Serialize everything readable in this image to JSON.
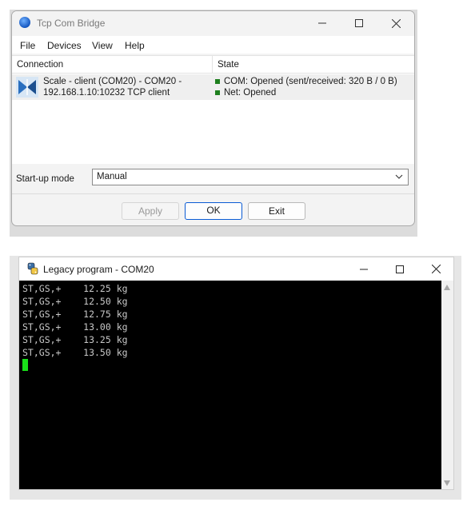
{
  "bridge": {
    "title": "Tcp Com Bridge",
    "menu": [
      "File",
      "Devices",
      "View",
      "Help"
    ],
    "columns": {
      "connection": "Connection",
      "state": "State"
    },
    "row": {
      "line1": "Scale - client (COM20) - COM20 -",
      "line2": "192.168.1.10:10232 TCP client",
      "com_state": "COM: Opened (sent/received: 320 B / 0 B)",
      "net_state": "Net: Opened"
    },
    "startup": {
      "label": "Start-up mode",
      "value": "Manual"
    },
    "buttons": {
      "apply": "Apply",
      "ok": "OK",
      "exit": "Exit"
    },
    "status_color": "#1e7f1e",
    "accent": "#0a5bd4"
  },
  "legacy": {
    "title": "Legacy program - COM20",
    "lines": [
      "ST,GS,+    12.25 kg",
      "ST,GS,+    12.50 kg",
      "ST,GS,+    12.75 kg",
      "ST,GS,+    13.00 kg",
      "ST,GS,+    13.25 kg",
      "ST,GS,+    13.50 kg"
    ],
    "cursor_color": "#19e019"
  }
}
